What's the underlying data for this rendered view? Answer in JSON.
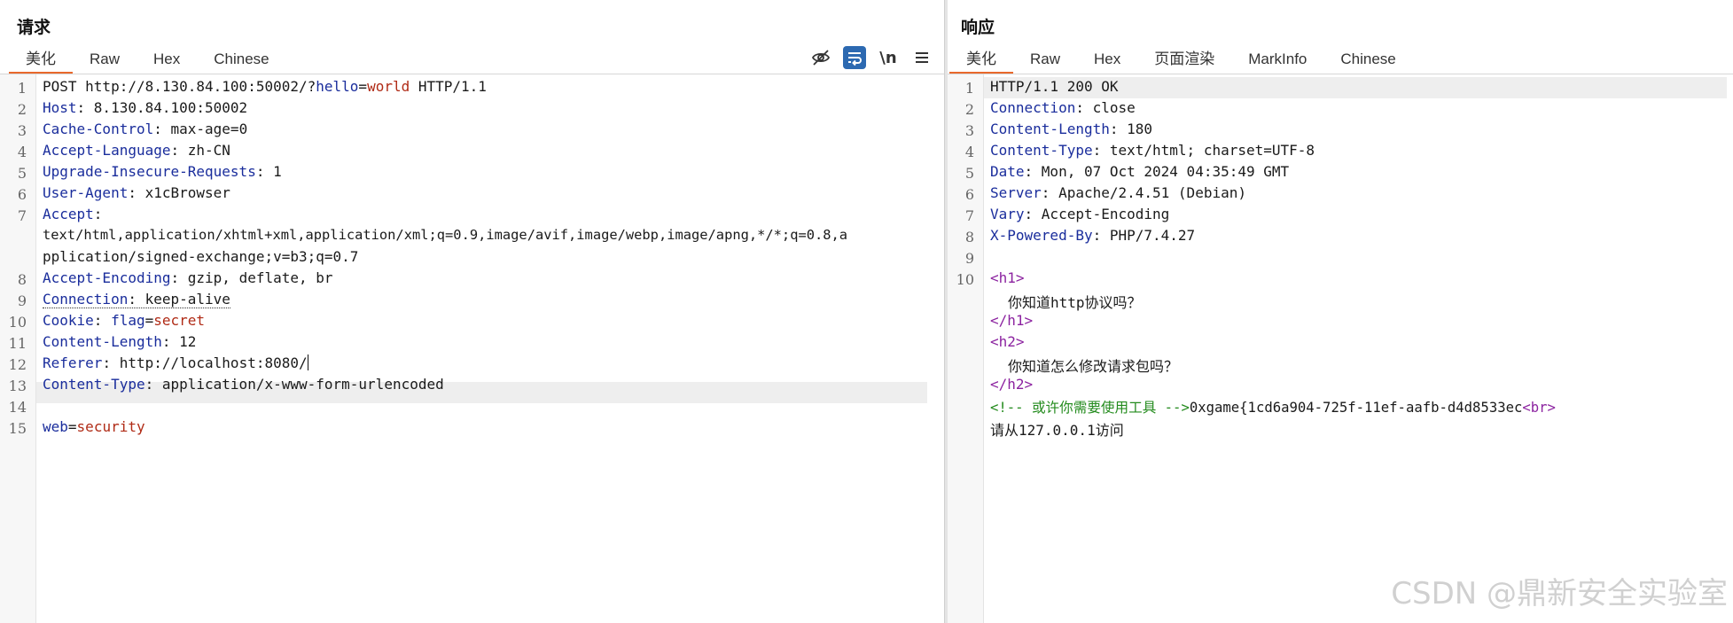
{
  "request": {
    "title": "请求",
    "tabs": [
      "美化",
      "Raw",
      "Hex",
      "Chinese"
    ],
    "active_tab": "美化",
    "toolbar": {
      "icons": [
        "eye-hidden-icon",
        "wrap-icon",
        "newline-toggle",
        "menu-icon"
      ],
      "newline_label": "\\n",
      "wrap_active": true,
      "active_color": "#2c69b1"
    },
    "lines": {
      "l1": {
        "num": "1",
        "method": "POST http://8.130.84.100:50002/?",
        "qkey": "hello",
        "eq": "=",
        "qval": "world",
        "proto": " HTTP/1.1"
      },
      "l2": {
        "num": "2",
        "key": "Host",
        "val": ": 8.130.84.100:50002"
      },
      "l3": {
        "num": "3",
        "key": "Cache-Control",
        "val": ": max-age=0"
      },
      "l4": {
        "num": "4",
        "key": "Accept-Language",
        "val": ": zh-CN"
      },
      "l5": {
        "num": "5",
        "key": "Upgrade-Insecure-Requests",
        "val": ": 1"
      },
      "l6": {
        "num": "6",
        "key": "User-Agent",
        "val": ": x1cBrowser"
      },
      "l7": {
        "num": "7",
        "key": "Accept",
        "val": ":",
        "wrap1": "text/html,application/xhtml+xml,application/xml;q=0.9,image/avif,image/webp,image/apng,*/*;q=0.8,a",
        "wrap2": "pplication/signed-exchange;v=b3;q=0.7"
      },
      "l8": {
        "num": "8",
        "key": "Accept-Encoding",
        "val": ": gzip, deflate, br"
      },
      "l9": {
        "num": "9",
        "key": "Connection",
        "val": ": keep-alive"
      },
      "l10": {
        "num": "10",
        "key": "Cookie",
        "sep": ": ",
        "ckey": "flag",
        "eq": "=",
        "cval": "secret"
      },
      "l11": {
        "num": "11",
        "key": "Content-Length",
        "val": ": 12"
      },
      "l12": {
        "num": "12",
        "key": "Referer",
        "val": ": http://localhost:8080/"
      },
      "l13": {
        "num": "13",
        "key": "Content-Type",
        "val": ": application/x-www-form-urlencoded"
      },
      "l14": {
        "num": "14"
      },
      "l15": {
        "num": "15",
        "bkey": "web",
        "eq": "=",
        "bval": "security"
      }
    },
    "colors": {
      "key": "#1a2d9c",
      "value": "#b02b16"
    }
  },
  "response": {
    "title": "响应",
    "tabs": [
      "美化",
      "Raw",
      "Hex",
      "页面渲染",
      "MarkInfo",
      "Chinese"
    ],
    "active_tab": "美化",
    "lines": {
      "l1": {
        "num": "1",
        "text": "HTTP/1.1 200 OK"
      },
      "l2": {
        "num": "2",
        "key": "Connection",
        "val": ": close"
      },
      "l3": {
        "num": "3",
        "key": "Content-Length",
        "val": ": 180"
      },
      "l4": {
        "num": "4",
        "key": "Content-Type",
        "val": ": text/html; charset=UTF-8"
      },
      "l5": {
        "num": "5",
        "key": "Date",
        "val": ": Mon, 07 Oct 2024 04:35:49 GMT"
      },
      "l6": {
        "num": "6",
        "key": "Server",
        "val": ": Apache/2.4.51 (Debian)"
      },
      "l7": {
        "num": "7",
        "key": "Vary",
        "val": ": Accept-Encoding"
      },
      "l8": {
        "num": "8",
        "key": "X-Powered-By",
        "val": ": PHP/7.4.27"
      },
      "l9": {
        "num": "9"
      },
      "l10": {
        "num": "10",
        "h1_open": "<h1>",
        "h1_text": "你知道http协议吗？",
        "h1_close": "</h1>",
        "h2_open": "<h2>",
        "h2_text": "你知道怎么修改请求包吗？",
        "h2_close": "</h2>",
        "comment": "<!-- 或许你需要使用工具 -->",
        "flag": "0xgame{1cd6a904-725f-11ef-aafb-d4d8533ec",
        "br": "<br>",
        "last": "请从127.0.0.1访问"
      }
    },
    "colors": {
      "tag": "#8c23a0",
      "comment": "#238b1d"
    }
  },
  "watermark": "CSDN @鼎新安全实验室"
}
